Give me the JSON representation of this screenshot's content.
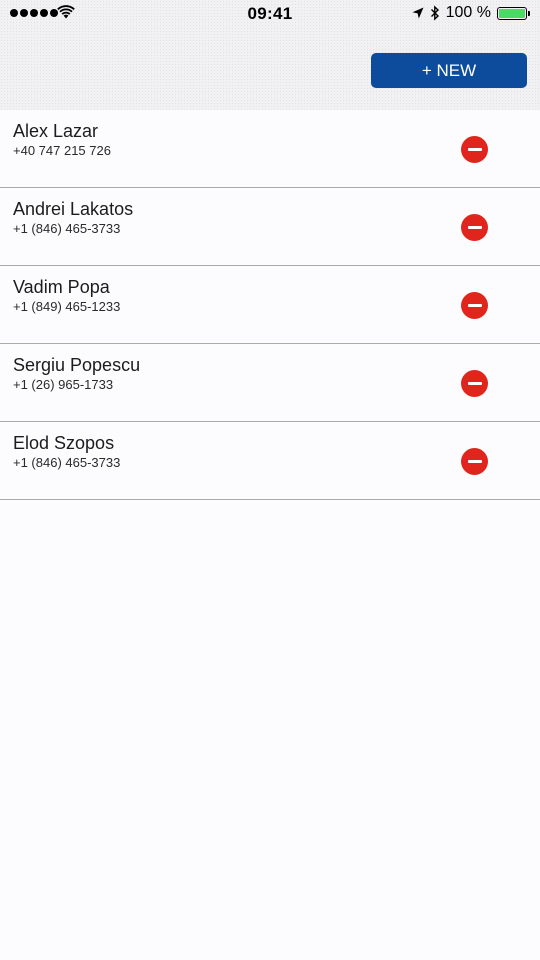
{
  "status_bar": {
    "time": "09:41",
    "battery_text": "100 %",
    "battery_level": 1.0,
    "signal_bars": 5
  },
  "toolbar": {
    "new_label": "+ NEW"
  },
  "contacts": [
    {
      "name": "Alex Lazar",
      "phone": "+40 747 215 726"
    },
    {
      "name": "Andrei Lakatos",
      "phone": "+1 (846) 465-3733"
    },
    {
      "name": "Vadim Popa",
      "phone": "+1 (849) 465-1233"
    },
    {
      "name": "Sergiu Popescu",
      "phone": "+1 (26) 965-1733"
    },
    {
      "name": "Elod Szopos",
      "phone": "+1 (846) 465-3733"
    }
  ],
  "colors": {
    "primary": "#0d4b9c",
    "delete": "#e0261c",
    "battery": "#4cd964"
  },
  "icons": {
    "signal": "signal-dots-icon",
    "wifi": "wifi-icon",
    "location": "location-arrow-icon",
    "bluetooth": "bluetooth-icon",
    "battery": "battery-icon",
    "delete": "minus-circle-icon"
  }
}
